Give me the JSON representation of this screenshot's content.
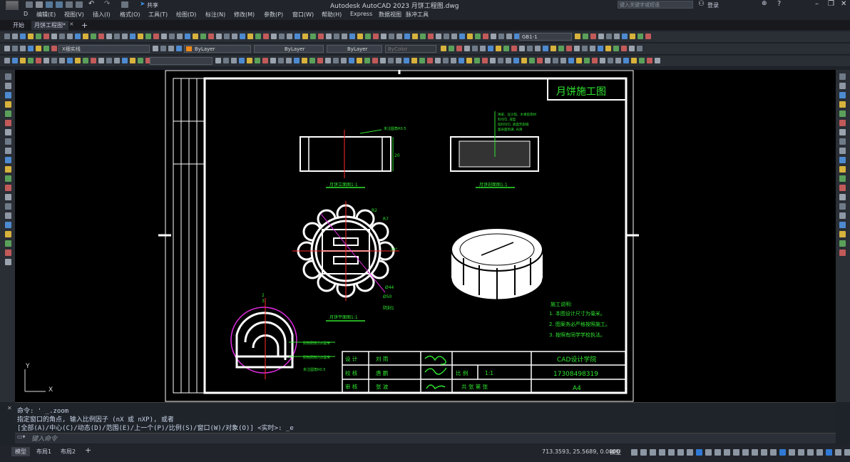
{
  "app": {
    "title": "Autodesk AutoCAD 2023    月饼工程图.dwg",
    "share_label": "共享",
    "search_placeholder": "键入关键字或短语",
    "login_label": "登录",
    "window_controls": [
      "–",
      "❐",
      "✕"
    ]
  },
  "menu": [
    "D",
    "编辑(E)",
    "视图(V)",
    "插入(I)",
    "格式(O)",
    "工具(T)",
    "绘图(D)",
    "标注(N)",
    "修改(M)",
    "参数(P)",
    "窗口(W)",
    "帮助(H)",
    "Express",
    "数据视图",
    "脉冲工具"
  ],
  "tabs": {
    "start": "开始",
    "active": "月饼工程图*",
    "add": "+"
  },
  "toolbar": {
    "dimstyle": "GB1-1",
    "layer": "X细实线",
    "color": "ByLayer",
    "linetype": "ByLayer",
    "lineweight": "ByLayer",
    "plotstyle": "ByColor"
  },
  "drawing": {
    "title_box": "月饼施工图",
    "front_view_label": "月饼立面图1:1",
    "section_view_label": "月饼剖面图1:1",
    "plan_view_label": "月饼平面图1:1",
    "front_note": "未注圆角R0.5",
    "section_notes": [
      "饼皮、豆沙馅、水果馅等材",
      "料均匀, 成型",
      "馅料均匀, 底面无裂缝",
      "面表面饱满, 光滑"
    ],
    "plan_dims": [
      "R2",
      "R7",
      "30°",
      "Ø44",
      "Ø50",
      "阴刻1"
    ],
    "detail_dims": [
      "2",
      "3"
    ],
    "detail_notes": [
      "阴刻阳刻为1毫米",
      "阴刻阳刻为2毫米",
      "未注圆角R0.5"
    ],
    "notes_title": "施工说明:",
    "notes": [
      "1. 本图设计尺寸为毫米。",
      "2. 图案务必严格按照施工。",
      "3. 按照有同学学校执法。"
    ],
    "title_block": {
      "row1": [
        "设 计",
        "刘 雨"
      ],
      "row2": [
        "校 核",
        "唐 鹏",
        "比 例",
        "1:1"
      ],
      "row3": [
        "审 核",
        "张 波",
        "共 张 第 张"
      ],
      "school": "CAD设计学院",
      "number": "17308498319",
      "sheet": "A4"
    },
    "ucs": {
      "x": "X",
      "y": "Y"
    }
  },
  "command": {
    "line1": "命令: ' _.zoom",
    "line2": "指定窗口的角点, 输入比例因子 (nX 或 nXP), 或者",
    "line3": "[全部(A)/中心(C)/动态(D)/范围(E)/上一个(P)/比例(S)/窗口(W)/对象(O)] <实时>: _e",
    "input_placeholder": "键入命令"
  },
  "status": {
    "tabs": [
      "模型",
      "布局1",
      "布局2",
      "+"
    ],
    "coords": "713.3593, 25.5689, 0.0000",
    "model_label": "模型"
  },
  "colors": {
    "accent": "#2f7ad6",
    "canvas": "#000000",
    "drawing_line": "#ffffff",
    "dim_green": "#2fe52f",
    "dim_red": "#ff2b2b",
    "magenta": "#e02be0"
  }
}
